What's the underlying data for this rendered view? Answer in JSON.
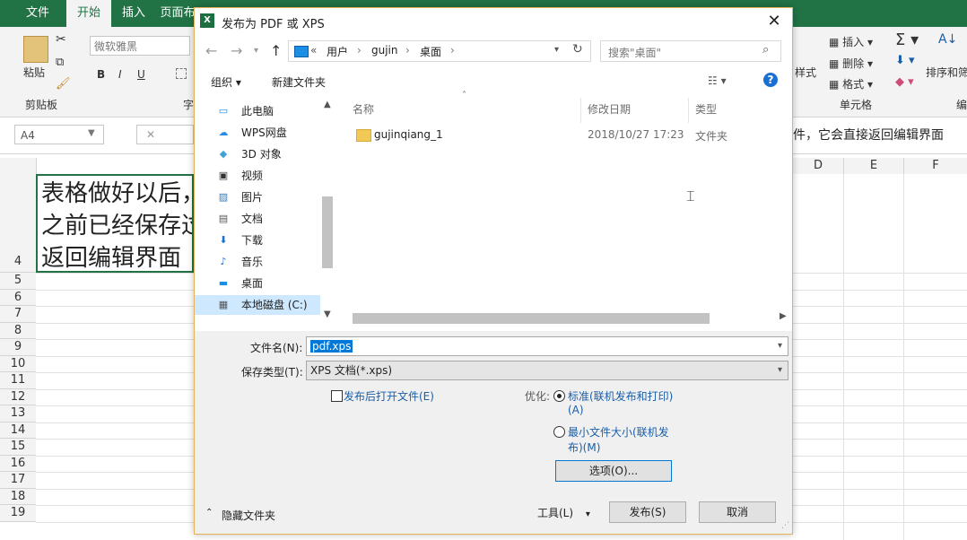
{
  "excel": {
    "tabs": [
      "文件",
      "开始",
      "插入",
      "页面布"
    ],
    "active_tab": "开始",
    "font_name": "微软雅黑",
    "clipboard_paste": "粘贴",
    "clipboard_group": "剪贴板",
    "font_group_partial": "字",
    "bold": "B",
    "italic": "I",
    "underline": "U",
    "styles_label": "样式",
    "insert": "插入",
    "delete": "删除",
    "format": "格式",
    "cells_group": "单元格",
    "sort_filter": "排序和筛",
    "edit_group_partial": "编",
    "name_box": "A4",
    "formula_text": "件，它会直接返回编辑界面",
    "columns": [
      "D",
      "E",
      "F"
    ],
    "rows": [
      "4",
      "5",
      "6",
      "7",
      "8",
      "9",
      "10",
      "11",
      "12",
      "13",
      "14",
      "15",
      "16",
      "17",
      "18",
      "19"
    ],
    "cell_a4_lines": [
      "表格做好以后，",
      "之前已经保存过",
      "返回编辑界面"
    ]
  },
  "dialog": {
    "title": "发布为 PDF 或 XPS",
    "close": "✕",
    "breadcrumb": [
      "«",
      "用户",
      "gujin",
      "桌面"
    ],
    "search_placeholder": "搜索\"桌面\"",
    "organize": "组织 ▾",
    "new_folder": "新建文件夹",
    "help": "?",
    "nav_items": [
      {
        "icon": "computer-icon",
        "label": "此电脑"
      },
      {
        "icon": "cloud-icon",
        "label": "WPS网盘"
      },
      {
        "icon": "cube-icon",
        "label": "3D 对象"
      },
      {
        "icon": "video-icon",
        "label": "视频"
      },
      {
        "icon": "picture-icon",
        "label": "图片"
      },
      {
        "icon": "document-icon",
        "label": "文档"
      },
      {
        "icon": "download-icon",
        "label": "下载"
      },
      {
        "icon": "music-icon",
        "label": "音乐"
      },
      {
        "icon": "desktop-icon",
        "label": "桌面"
      },
      {
        "icon": "drive-icon",
        "label": "本地磁盘 (C:)"
      }
    ],
    "columns": {
      "name": "名称",
      "modified": "修改日期",
      "type": "类型"
    },
    "files": [
      {
        "name": "gujinqiang_1",
        "modified": "2018/10/27 17:23",
        "type": "文件夹"
      }
    ],
    "filename_label": "文件名(N):",
    "filename_value": "pdf.xps",
    "filetype_label": "保存类型(T):",
    "filetype_value": "XPS 文档(*.xps)",
    "open_after_publish": "发布后打开文件(E)",
    "optimize_label": "优化:",
    "opt_standard_1": "标准(联机发布和打印)",
    "opt_standard_2": "(A)",
    "opt_min_1": "最小文件大小(联机发",
    "opt_min_2": "布)(M)",
    "options_button": "选项(O)...",
    "hide_folders": "隐藏文件夹",
    "tools": "工具(L)",
    "publish": "发布(S)",
    "cancel": "取消"
  }
}
